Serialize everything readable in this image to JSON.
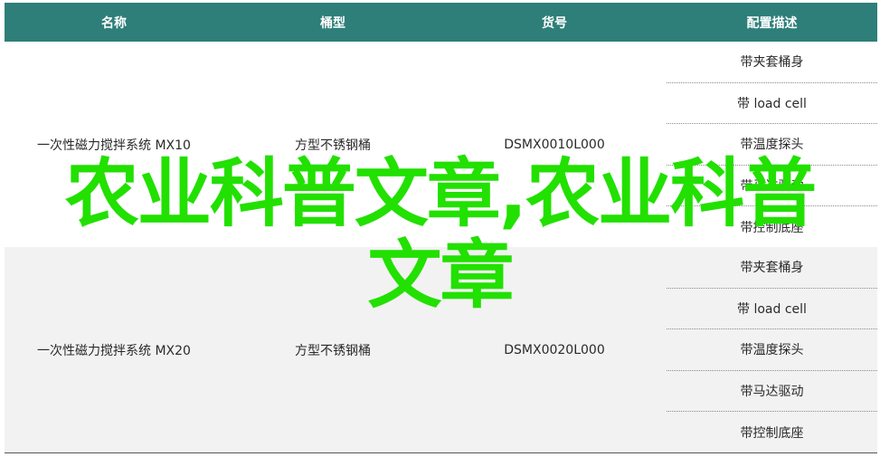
{
  "table": {
    "headers": [
      "名称",
      "桶型",
      "货号",
      "配置描述"
    ],
    "rows": [
      {
        "name": "一次性磁力搅拌系统 MX10",
        "type": "方型不锈钢桶",
        "sku": "DSMX0010L000",
        "configs": [
          "带夹套桶身",
          "带 load cell",
          "带温度探头",
          "带马达驱动",
          "带控制底座"
        ]
      },
      {
        "name": "一次性磁力搅拌系统 MX20",
        "type": "方型不锈钢桶",
        "sku": "DSMX0020L000",
        "configs": [
          "带夹套桶身",
          "带 load cell",
          "带温度探头",
          "带马达驱动",
          "带控制底座"
        ]
      }
    ]
  },
  "overlay": {
    "line1": "农业科普文章,农业科普",
    "line2": "文章"
  },
  "colors": {
    "header_bg": "#2e7f79",
    "overlay_text": "#22e000",
    "alt_row_bg": "#f2f2f2"
  }
}
